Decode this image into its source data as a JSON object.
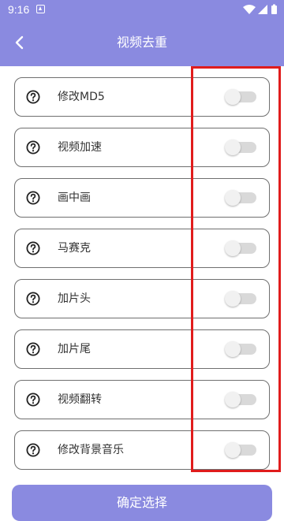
{
  "status_bar": {
    "time": "9:16"
  },
  "header": {
    "title": "视频去重",
    "back_icon": "chevron-left-icon"
  },
  "options": [
    {
      "label": "修改MD5",
      "enabled": false
    },
    {
      "label": "视频加速",
      "enabled": false
    },
    {
      "label": "画中画",
      "enabled": false
    },
    {
      "label": "马赛克",
      "enabled": false
    },
    {
      "label": "加片头",
      "enabled": false
    },
    {
      "label": "加片尾",
      "enabled": false
    },
    {
      "label": "视频翻转",
      "enabled": false
    },
    {
      "label": "修改背景音乐",
      "enabled": false
    }
  ],
  "confirm_button": {
    "label": "确定选择"
  },
  "colors": {
    "accent": "#8a8ae0",
    "highlight": "#e01c1c",
    "toggle_off_track": "#d9d9d9"
  }
}
